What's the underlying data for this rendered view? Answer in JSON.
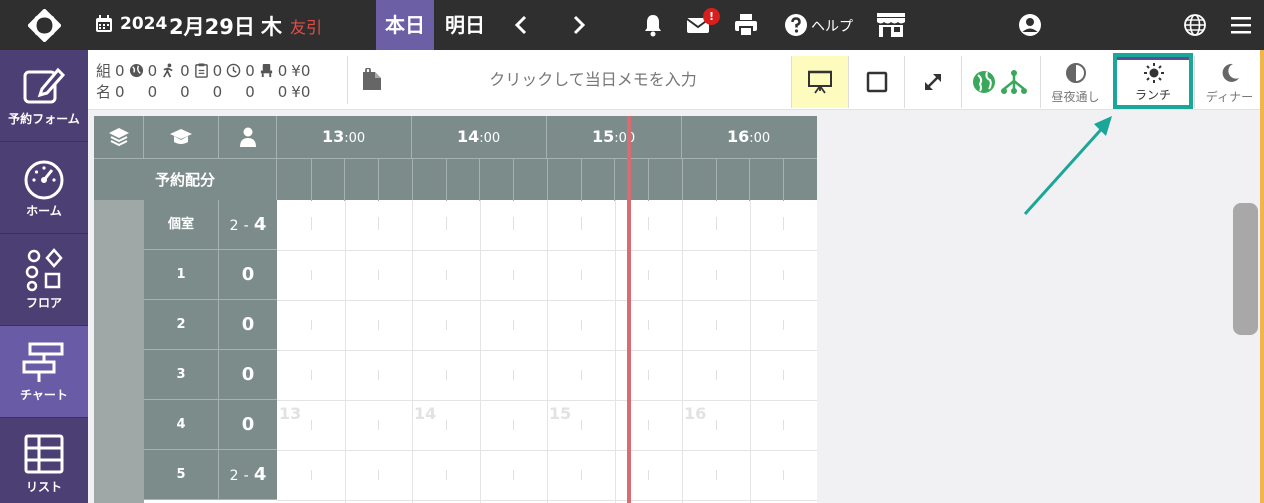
{
  "topbar": {
    "year": "2024",
    "month_day": "2月29日",
    "weekday": "木",
    "rokuyo": "友引",
    "today_label": "本日",
    "tomorrow_label": "明日",
    "mail_badge": "!",
    "help_label": "ヘルプ"
  },
  "sidebar": {
    "items": [
      {
        "label": "予約フォーム",
        "icon": "edit-icon"
      },
      {
        "label": "ホーム",
        "icon": "speedometer-icon"
      },
      {
        "label": "フロア",
        "icon": "shapes-icon"
      },
      {
        "label": "チャート",
        "icon": "chart-icon",
        "active": true
      },
      {
        "label": "リスト",
        "icon": "table-icon"
      }
    ]
  },
  "stats": {
    "row1_prefix": "組",
    "row2_prefix": "名",
    "row1": [
      "0",
      "0",
      "0",
      "0",
      "0",
      "0",
      "¥0"
    ],
    "row2": [
      "0",
      "0",
      "0",
      "0",
      "0",
      "0",
      "¥0"
    ]
  },
  "memo": {
    "placeholder": "クリックして当日メモを入力"
  },
  "modes": {
    "all_day": "昼夜通し",
    "lunch": "ランチ",
    "dinner": "ディナー"
  },
  "chart": {
    "hours": [
      "13",
      "14",
      "15",
      "16"
    ],
    "hour_suffix": ":00",
    "allocation_label": "予約配分",
    "rows": [
      {
        "label": "個室",
        "cap_min": "2",
        "cap_sep": "-",
        "cap_max": "4"
      },
      {
        "label": "1",
        "cap": "0"
      },
      {
        "label": "2",
        "cap": "0"
      },
      {
        "label": "3",
        "cap": "0"
      },
      {
        "label": "4",
        "cap": "0"
      },
      {
        "label": "5",
        "cap_min": "2",
        "cap_sep": "-",
        "cap_max": "4"
      }
    ],
    "watermarks": [
      "13",
      "14",
      "15",
      "16"
    ]
  },
  "colors": {
    "topbar": "#2f2f2f",
    "accent_purple": "#6d5fa5",
    "sidebar": "#4b3f73",
    "chart_header": "#7b8c8a",
    "now_line": "#d96b72",
    "highlight_teal": "#1aa698",
    "weekday_red": "#e0504a"
  }
}
